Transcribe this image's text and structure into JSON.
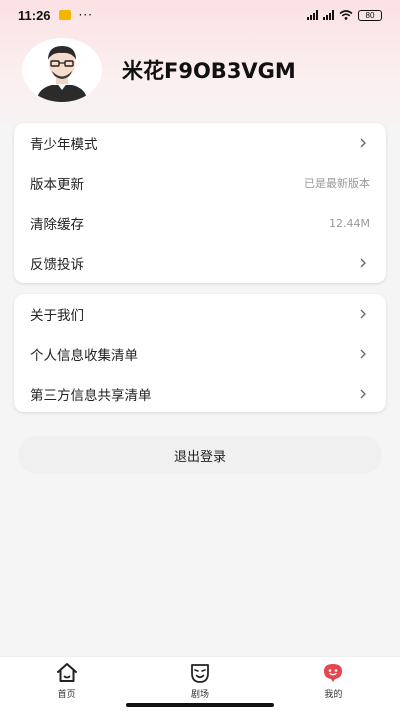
{
  "status_bar": {
    "time": "11:26",
    "more": "···",
    "battery": "80"
  },
  "profile": {
    "username": "米花F9OB3VGM"
  },
  "settings_group_1": [
    {
      "label": "青少年模式",
      "value": "",
      "chevron": true
    },
    {
      "label": "版本更新",
      "value": "已是最新版本",
      "chevron": false
    },
    {
      "label": "清除缓存",
      "value": "12.44M",
      "chevron": false
    },
    {
      "label": "反馈投诉",
      "value": "",
      "chevron": true
    }
  ],
  "settings_group_2": [
    {
      "label": "关于我们",
      "chevron": true
    },
    {
      "label": "个人信息收集清单",
      "chevron": true
    },
    {
      "label": "第三方信息共享清单",
      "chevron": true
    }
  ],
  "logout": {
    "label": "退出登录"
  },
  "tabbar": {
    "tabs": [
      {
        "label": "首页",
        "icon": "home-icon"
      },
      {
        "label": "剧场",
        "icon": "theater-mask-icon"
      },
      {
        "label": "我的",
        "icon": "profile-face-icon"
      }
    ],
    "active_color": "#e5474f"
  }
}
